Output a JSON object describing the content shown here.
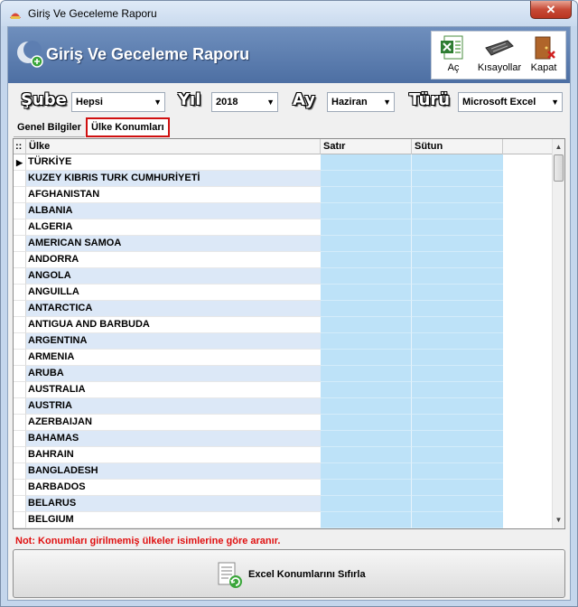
{
  "window": {
    "title": "Giriş Ve Geceleme Raporu",
    "close_label": "✕"
  },
  "banner": {
    "title": "Giriş Ve Geceleme Raporu"
  },
  "toolbar": {
    "open_label": "Aç",
    "shortcuts_label": "Kısayollar",
    "close_label": "Kapat"
  },
  "filters": {
    "branch_label": "Şube",
    "branch_value": "Hepsi",
    "year_label": "Yıl",
    "year_value": "2018",
    "month_label": "Ay",
    "month_value": "Haziran",
    "type_label": "Türü",
    "type_value": "Microsoft Excel"
  },
  "tabs": [
    {
      "label": "Genel Bilgiler",
      "active": false
    },
    {
      "label": "Ülke Konumları",
      "active": true
    }
  ],
  "grid": {
    "selector_header": "::",
    "columns": [
      "Ülke",
      "Satır",
      "Sütun"
    ],
    "selected_marker": "▶",
    "rows": [
      {
        "country": "TÜRKİYE",
        "row": "",
        "col": ""
      },
      {
        "country": "KUZEY KIBRIS TURK CUMHURİYETİ",
        "row": "",
        "col": ""
      },
      {
        "country": "AFGHANISTAN",
        "row": "",
        "col": ""
      },
      {
        "country": "ALBANIA",
        "row": "",
        "col": ""
      },
      {
        "country": "ALGERIA",
        "row": "",
        "col": ""
      },
      {
        "country": "AMERICAN SAMOA",
        "row": "",
        "col": ""
      },
      {
        "country": "ANDORRA",
        "row": "",
        "col": ""
      },
      {
        "country": "ANGOLA",
        "row": "",
        "col": ""
      },
      {
        "country": "ANGUILLA",
        "row": "",
        "col": ""
      },
      {
        "country": "ANTARCTICA",
        "row": "",
        "col": ""
      },
      {
        "country": "ANTIGUA AND BARBUDA",
        "row": "",
        "col": ""
      },
      {
        "country": "ARGENTINA",
        "row": "",
        "col": ""
      },
      {
        "country": "ARMENIA",
        "row": "",
        "col": ""
      },
      {
        "country": "ARUBA",
        "row": "",
        "col": ""
      },
      {
        "country": "AUSTRALIA",
        "row": "",
        "col": ""
      },
      {
        "country": "AUSTRIA",
        "row": "",
        "col": ""
      },
      {
        "country": "AZERBAIJAN",
        "row": "",
        "col": ""
      },
      {
        "country": "BAHAMAS",
        "row": "",
        "col": ""
      },
      {
        "country": "BAHRAIN",
        "row": "",
        "col": ""
      },
      {
        "country": "BANGLADESH",
        "row": "",
        "col": ""
      },
      {
        "country": "BARBADOS",
        "row": "",
        "col": ""
      },
      {
        "country": "BELARUS",
        "row": "",
        "col": ""
      },
      {
        "country": "BELGIUM",
        "row": "",
        "col": ""
      }
    ]
  },
  "note": "Not: Konumları girilmemiş ülkeler isimlerine göre aranır.",
  "reset_button": {
    "label": "Excel Konumlarını Sıfırla"
  },
  "colors": {
    "banner": "#5b7db1",
    "highlight": "#d01010",
    "cell_blue": "#bde2f8",
    "row_alt": "#dce8f7"
  }
}
